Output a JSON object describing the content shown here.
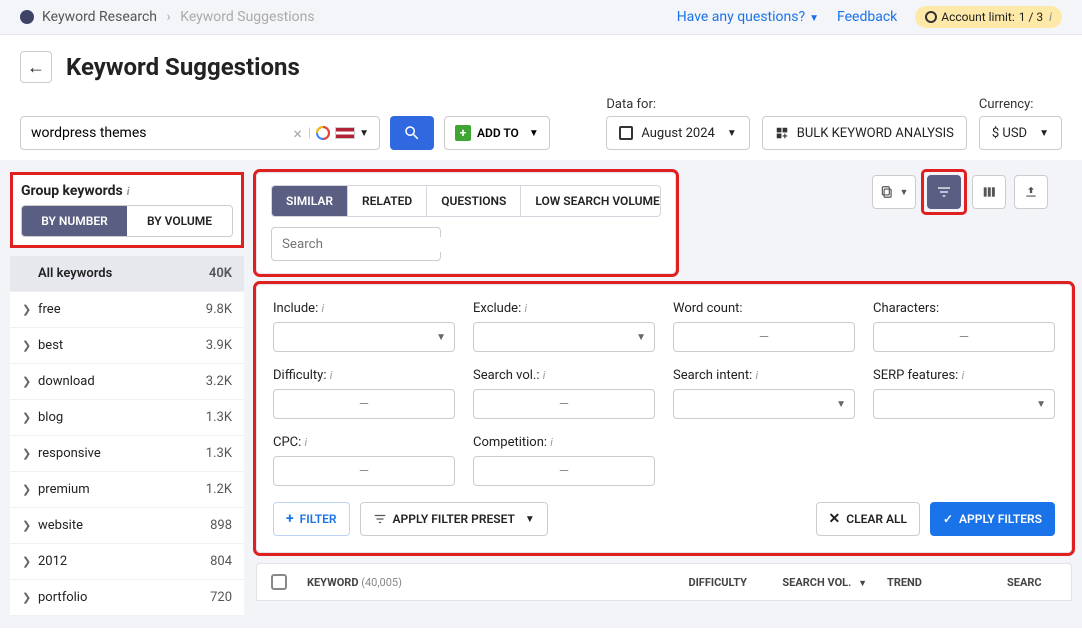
{
  "breadcrumb": {
    "root": "Keyword Research",
    "page": "Keyword Suggestions"
  },
  "topbar": {
    "questions": "Have any questions?",
    "feedback": "Feedback",
    "account_label": "Account limit:",
    "account_value": "1 / 3"
  },
  "header": {
    "title": "Keyword Suggestions",
    "search_value": "wordpress themes",
    "addto": "ADD TO"
  },
  "datafor": {
    "label": "Data for:",
    "value": "August 2024"
  },
  "bulk": {
    "label": "BULK KEYWORD ANALYSIS"
  },
  "currency": {
    "label": "Currency:",
    "value": "$ USD"
  },
  "group": {
    "title": "Group keywords",
    "by_number": "BY NUMBER",
    "by_volume": "BY VOLUME"
  },
  "all_keywords": {
    "label": "All keywords",
    "value": "40K"
  },
  "keyword_groups": [
    {
      "name": "free",
      "value": "9.8K"
    },
    {
      "name": "best",
      "value": "3.9K"
    },
    {
      "name": "download",
      "value": "3.2K"
    },
    {
      "name": "blog",
      "value": "1.3K"
    },
    {
      "name": "responsive",
      "value": "1.3K"
    },
    {
      "name": "premium",
      "value": "1.2K"
    },
    {
      "name": "website",
      "value": "898"
    },
    {
      "name": "2012",
      "value": "804"
    },
    {
      "name": "portfolio",
      "value": "720"
    }
  ],
  "tabs": {
    "similar": "SIMILAR",
    "related": "RELATED",
    "questions": "QUESTIONS",
    "low": "LOW SEARCH VOLUME",
    "search_placeholder": "Search"
  },
  "filters": {
    "include": "Include:",
    "exclude": "Exclude:",
    "word_count": "Word count:",
    "characters": "Characters:",
    "difficulty": "Difficulty:",
    "search_vol": "Search vol.:",
    "search_intent": "Search intent:",
    "serp": "SERP features:",
    "cpc": "CPC:",
    "competition": "Competition:"
  },
  "filter_actions": {
    "filter": "FILTER",
    "preset": "APPLY FILTER PRESET",
    "clear": "CLEAR ALL",
    "apply": "APPLY FILTERS"
  },
  "table": {
    "keyword": "KEYWORD",
    "count": "(40,005)",
    "difficulty": "DIFFICULTY",
    "search_vol": "SEARCH VOL.",
    "trend": "TREND",
    "search": "SEARC"
  }
}
